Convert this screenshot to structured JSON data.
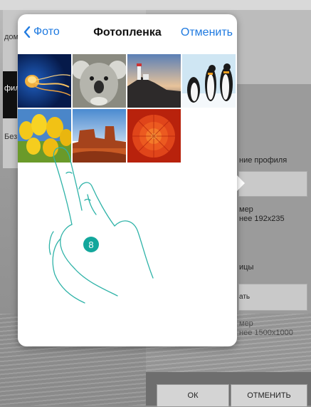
{
  "background": {
    "left_texts": [
      "дом",
      "фил",
      "Без"
    ],
    "right_labels": {
      "profile_image": "ние профиля",
      "size_profile": "мер\nнее 192x235",
      "page": "ицы",
      "size_page": "мер\nнее 1500x1000"
    },
    "field_button_text": "ать",
    "ok_label": "ОК",
    "cancel_label": "ОТМЕНИТЬ"
  },
  "popover": {
    "back_label": "Фото",
    "title": "Фотопленка",
    "cancel_label": "Отменить",
    "photos": [
      {
        "name": "jellyfish"
      },
      {
        "name": "koala"
      },
      {
        "name": "lighthouse"
      },
      {
        "name": "penguins"
      },
      {
        "name": "tulips"
      },
      {
        "name": "desert"
      },
      {
        "name": "chrysanthemum"
      }
    ]
  },
  "step_number": "8",
  "colors": {
    "accent": "#1f7ae0",
    "step": "#13a79c",
    "hand_stroke": "#2fb3a8"
  }
}
